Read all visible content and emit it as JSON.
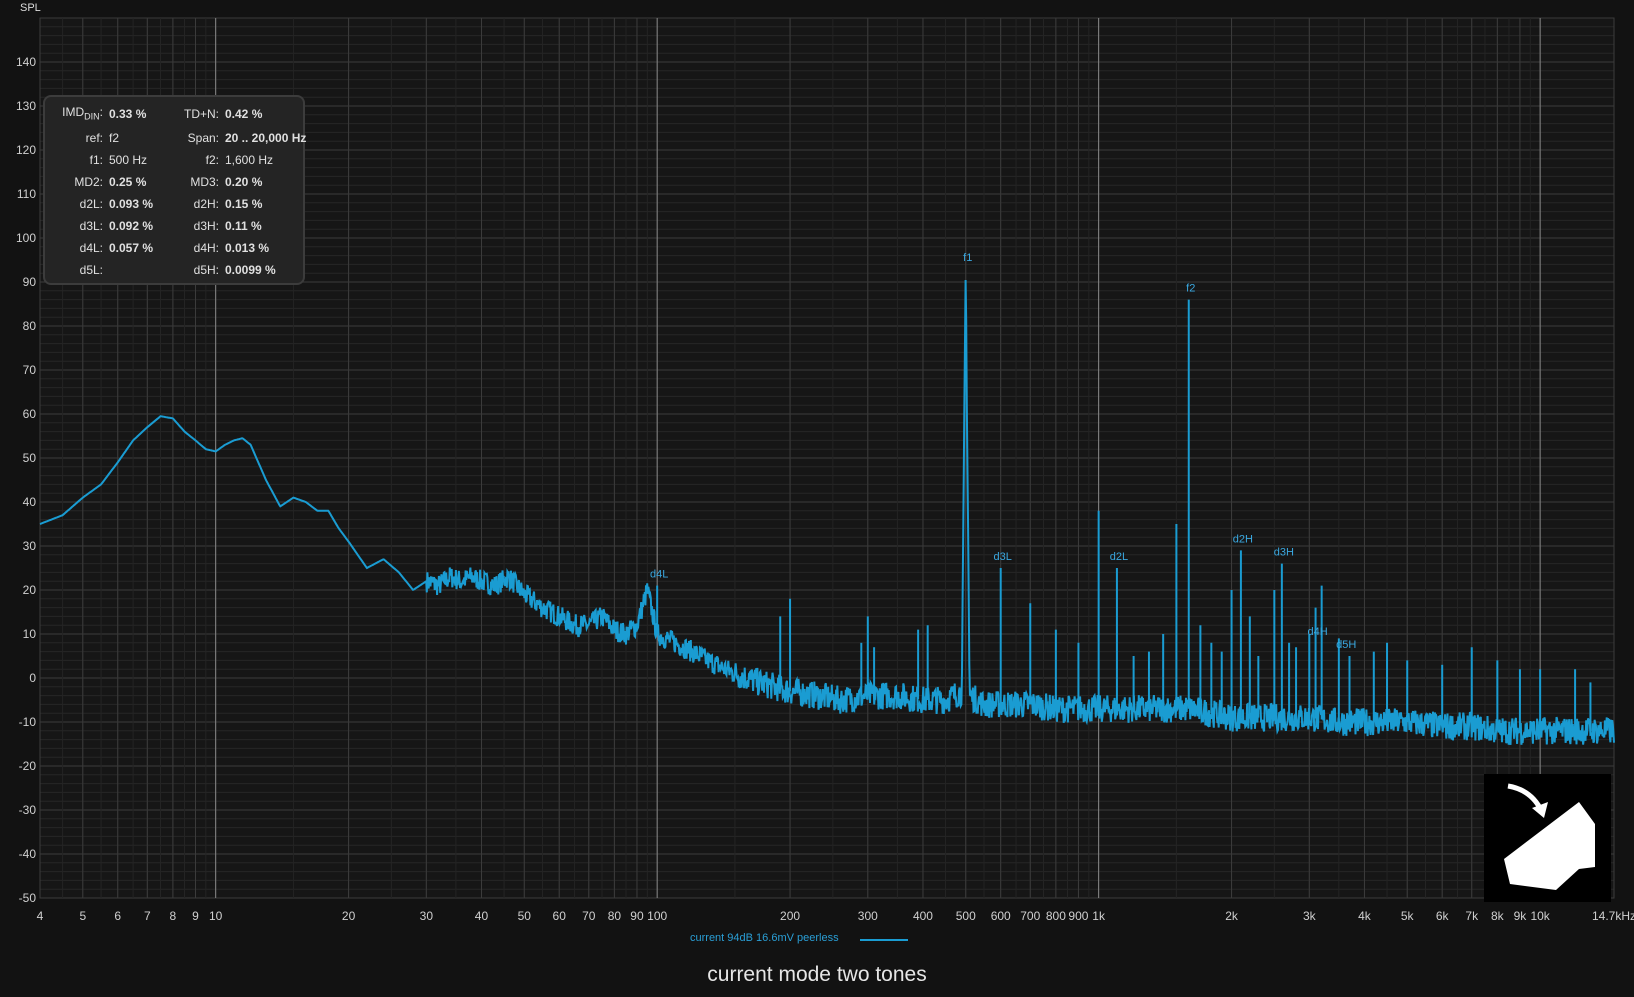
{
  "chart_data": {
    "type": "line",
    "title": "current mode two tones",
    "ylabel": "SPL",
    "x_scale": "log",
    "xlim": [
      4,
      14700
    ],
    "ylim": [
      -50,
      150
    ],
    "yticks": [
      140,
      130,
      120,
      110,
      100,
      90,
      80,
      70,
      60,
      50,
      40,
      30,
      20,
      10,
      0,
      -10,
      -20,
      -30,
      -40,
      -50
    ],
    "xticks": [
      {
        "v": 4,
        "label": "4"
      },
      {
        "v": 5,
        "label": "5"
      },
      {
        "v": 6,
        "label": "6"
      },
      {
        "v": 7,
        "label": "7"
      },
      {
        "v": 8,
        "label": "8"
      },
      {
        "v": 9,
        "label": "9"
      },
      {
        "v": 10,
        "label": "10"
      },
      {
        "v": 20,
        "label": "20"
      },
      {
        "v": 30,
        "label": "30"
      },
      {
        "v": 40,
        "label": "40"
      },
      {
        "v": 50,
        "label": "50"
      },
      {
        "v": 60,
        "label": "60"
      },
      {
        "v": 70,
        "label": "70"
      },
      {
        "v": 80,
        "label": "80"
      },
      {
        "v": 90,
        "label": "90"
      },
      {
        "v": 100,
        "label": "100"
      },
      {
        "v": 200,
        "label": "200"
      },
      {
        "v": 300,
        "label": "300"
      },
      {
        "v": 400,
        "label": "400"
      },
      {
        "v": 500,
        "label": "500"
      },
      {
        "v": 600,
        "label": "600"
      },
      {
        "v": 700,
        "label": "700"
      },
      {
        "v": 800,
        "label": "800"
      },
      {
        "v": 900,
        "label": "900"
      },
      {
        "v": 1000,
        "label": "1k"
      },
      {
        "v": 2000,
        "label": "2k"
      },
      {
        "v": 3000,
        "label": "3k"
      },
      {
        "v": 4000,
        "label": "4k"
      },
      {
        "v": 5000,
        "label": "5k"
      },
      {
        "v": 6000,
        "label": "6k"
      },
      {
        "v": 7000,
        "label": "7k"
      },
      {
        "v": 8000,
        "label": "8k"
      },
      {
        "v": 9000,
        "label": "9k"
      },
      {
        "v": 10000,
        "label": "10k"
      },
      {
        "v": 14700,
        "label": "14.7kHz"
      }
    ],
    "grid": true,
    "legend_position": "bottom-center",
    "series": [
      {
        "name": "current 94dB 16.6mV peerless",
        "color": "#1a9cd2",
        "x": [
          4,
          4.5,
          5,
          5.5,
          6,
          6.5,
          7,
          7.5,
          8,
          8.5,
          9,
          9.5,
          10,
          10.5,
          11,
          11.5,
          12,
          13,
          14,
          15,
          16,
          17,
          18,
          19,
          20,
          22,
          24,
          26,
          28,
          30,
          32,
          34,
          36,
          38,
          40,
          43,
          46,
          50,
          55,
          60,
          65,
          70,
          75,
          80,
          85,
          90,
          95,
          100,
          110,
          120,
          130,
          150,
          170,
          200,
          230,
          260,
          300,
          350,
          400,
          450,
          490,
          500,
          510,
          550,
          600,
          700,
          800,
          900,
          1000,
          1200,
          1400,
          1600,
          1800,
          2000,
          2500,
          3000,
          3500,
          4000,
          5000,
          6000,
          7000,
          8000,
          9000,
          10000,
          12000,
          14700
        ],
        "y": [
          35,
          37,
          41,
          44,
          49,
          54,
          57,
          59.5,
          59,
          56,
          54,
          52,
          51.5,
          53,
          54,
          54.5,
          53,
          45,
          39,
          41,
          40,
          38,
          38,
          34,
          31,
          25,
          27,
          24,
          20,
          22,
          21,
          23,
          22,
          23,
          22,
          21,
          23,
          19,
          16,
          14,
          12,
          12,
          14,
          11,
          10,
          12,
          20,
          10,
          8,
          6,
          4,
          1,
          -1,
          -3,
          -4,
          -5,
          -4,
          -4,
          -5,
          -5,
          -3,
          93,
          -4,
          -6,
          -6,
          -6,
          -7,
          -7,
          -7,
          -7,
          -7,
          -7,
          -8,
          -9,
          -9,
          -9,
          -10,
          -10,
          -10,
          -11,
          -11,
          -12,
          -12,
          -12,
          -12,
          -12
        ]
      }
    ],
    "spikes": [
      {
        "f": 100,
        "db": 21
      },
      {
        "f": 190,
        "db": 14
      },
      {
        "f": 200,
        "db": 18
      },
      {
        "f": 290,
        "db": 8
      },
      {
        "f": 300,
        "db": 14
      },
      {
        "f": 310,
        "db": 7
      },
      {
        "f": 390,
        "db": 11
      },
      {
        "f": 410,
        "db": 12
      },
      {
        "f": 500,
        "db": 93
      },
      {
        "f": 600,
        "db": 25
      },
      {
        "f": 700,
        "db": 17
      },
      {
        "f": 800,
        "db": 11
      },
      {
        "f": 900,
        "db": 8
      },
      {
        "f": 1000,
        "db": 38
      },
      {
        "f": 1100,
        "db": 25
      },
      {
        "f": 1200,
        "db": 5
      },
      {
        "f": 1300,
        "db": 6
      },
      {
        "f": 1400,
        "db": 10
      },
      {
        "f": 1500,
        "db": 35
      },
      {
        "f": 1600,
        "db": 86
      },
      {
        "f": 1700,
        "db": 12
      },
      {
        "f": 1800,
        "db": 8
      },
      {
        "f": 1900,
        "db": 6
      },
      {
        "f": 2000,
        "db": 20
      },
      {
        "f": 2100,
        "db": 29
      },
      {
        "f": 2200,
        "db": 14
      },
      {
        "f": 2300,
        "db": 5
      },
      {
        "f": 2500,
        "db": 20
      },
      {
        "f": 2600,
        "db": 26
      },
      {
        "f": 2700,
        "db": 8
      },
      {
        "f": 2800,
        "db": 7
      },
      {
        "f": 3000,
        "db": 10
      },
      {
        "f": 3100,
        "db": 16
      },
      {
        "f": 3200,
        "db": 21
      },
      {
        "f": 3500,
        "db": 9
      },
      {
        "f": 3700,
        "db": 5
      },
      {
        "f": 4200,
        "db": 6
      },
      {
        "f": 4500,
        "db": 8
      },
      {
        "f": 5000,
        "db": 4
      },
      {
        "f": 6000,
        "db": 3
      },
      {
        "f": 7000,
        "db": 7
      },
      {
        "f": 8000,
        "db": 4
      },
      {
        "f": 9000,
        "db": 2
      },
      {
        "f": 10000,
        "db": 2
      },
      {
        "f": 12000,
        "db": 2
      },
      {
        "f": 13000,
        "db": -1
      }
    ],
    "annotations": [
      {
        "label": "f1",
        "f": 500,
        "db": 93
      },
      {
        "label": "f2",
        "f": 1600,
        "db": 86
      },
      {
        "label": "d4L",
        "f": 100,
        "db": 21
      },
      {
        "label": "d3L",
        "f": 600,
        "db": 25
      },
      {
        "label": "d2L",
        "f": 1100,
        "db": 25
      },
      {
        "label": "d2H",
        "f": 2100,
        "db": 29
      },
      {
        "label": "d3H",
        "f": 2600,
        "db": 26
      },
      {
        "label": "d4H",
        "f": 3100,
        "db": 8
      },
      {
        "label": "d5H",
        "f": 3600,
        "db": 5
      }
    ]
  },
  "stats": {
    "imd_label_main": "IMD",
    "imd_label_sub": "DIN",
    "imd_value": "0.33 %",
    "tdn_label": "TD+N:",
    "tdn_value": "0.42 %",
    "ref_label": "ref:",
    "ref_value": "f2",
    "span_label": "Span:",
    "span_value": "20 .. 20,000 Hz",
    "f1_label": "f1:",
    "f1_value": "500 Hz",
    "f2_label": "f2:",
    "f2_value": "1,600 Hz",
    "md2_label": "MD2:",
    "md2_value": "0.25 %",
    "md3_label": "MD3:",
    "md3_value": "0.20 %",
    "d2l_label": "d2L:",
    "d2l_value": "0.093 %",
    "d2h_label": "d2H:",
    "d2h_value": "0.15 %",
    "d3l_label": "d3L:",
    "d3l_value": "0.092 %",
    "d3h_label": "d3H:",
    "d3h_value": "0.11 %",
    "d4l_label": "d4L:",
    "d4l_value": "0.057 %",
    "d4h_label": "d4H:",
    "d4h_value": "0.013 %",
    "d5l_label": "d5L:",
    "d5h_label": "d5H:",
    "d5h_value": "0.0099 %"
  },
  "legend": {
    "series_label": "current 94dB 16.6mV peerless"
  },
  "logo": {
    "icon": "house-arrow-logo"
  }
}
